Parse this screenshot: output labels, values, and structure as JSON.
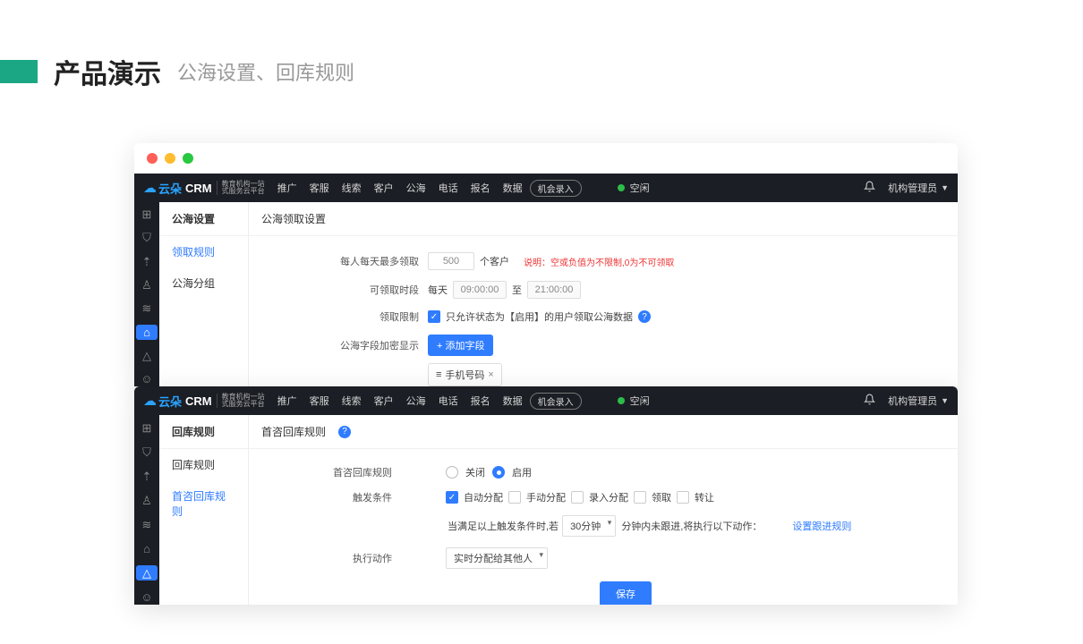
{
  "slide": {
    "title": "产品演示",
    "subtitle": "公海设置、回库规则"
  },
  "logo": {
    "brand": "云朵",
    "suffix": "CRM",
    "sub1": "教育机构一站",
    "sub2": "式服务云平台"
  },
  "topnav": {
    "items": [
      "推广",
      "客服",
      "线索",
      "客户",
      "公海",
      "电话",
      "报名",
      "数据"
    ],
    "action": "机会录入",
    "status": "空闲",
    "user": "机构管理员"
  },
  "rail_icons": [
    "grid",
    "shield",
    "chart",
    "user",
    "book",
    "home",
    "recycle",
    "person"
  ],
  "app1": {
    "section_title": "公海设置",
    "subnav": [
      "领取规则",
      "公海分组"
    ],
    "subnav_active": 0,
    "main_header": "公海领取设置",
    "row1": {
      "label": "每人每天最多领取",
      "value": "500",
      "suffix": "个客户",
      "hint": "说明：空或负值为不限制,0为不可领取"
    },
    "row2": {
      "label": "可领取时段",
      "daily": "每天",
      "start": "09:00:00",
      "to": "至",
      "end": "21:00:00"
    },
    "row3": {
      "label": "领取限制",
      "text": "只允许状态为【启用】的用户领取公海数据"
    },
    "row4": {
      "label": "公海字段加密显示",
      "btn": "+ 添加字段",
      "tag_prefix": "≡",
      "tag": "手机号码"
    }
  },
  "app2": {
    "section_title": "回库规则",
    "subnav": [
      "回库规则",
      "首咨回库规则"
    ],
    "subnav_active": 1,
    "main_header": "首咨回库规则",
    "row1": {
      "label": "首咨回库规则",
      "off": "关闭",
      "on": "启用"
    },
    "row2": {
      "label": "触发条件",
      "opts": [
        "自动分配",
        "手动分配",
        "录入分配",
        "领取",
        "转让"
      ]
    },
    "row3": {
      "label": "",
      "before": "当满足以上触发条件时,若",
      "sel": "30分钟",
      "after": "分钟内未跟进,将执行以下动作：",
      "link": "设置跟进规则"
    },
    "row4": {
      "label": "执行动作",
      "sel": "实时分配给其他人"
    },
    "save": "保存"
  }
}
